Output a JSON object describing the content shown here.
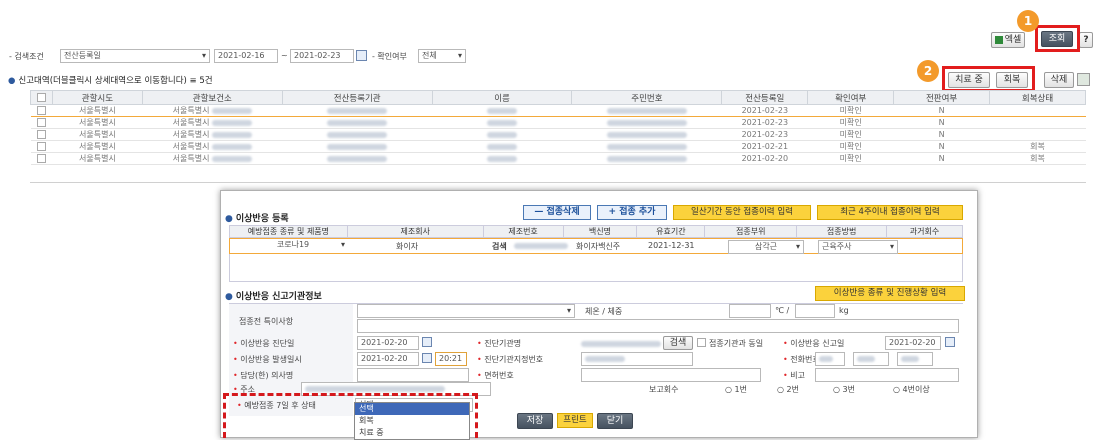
{
  "toolbar_top": {
    "excel_label": "엑셀",
    "search_button": "조회",
    "help_label": "?"
  },
  "step_badges": [
    "1",
    "2"
  ],
  "search": {
    "condition_label": "- 검색조건",
    "condition_value": "전산등록일",
    "date_from": "2021-02-16",
    "tilde": "~",
    "date_to": "2021-02-23",
    "confirm_label": "- 확인여부",
    "confirm_value": "전체"
  },
  "report_list": {
    "title": "신고대역(더블클릭시 상세대역으로 이동합니다) ≡ 5건",
    "actions": {
      "treating": "치료 중",
      "recovered": "회복",
      "delete": "삭제"
    },
    "columns": [
      "관할시도",
      "관할보건소",
      "전산등록기관",
      "이름",
      "주민번호",
      "전산등록일",
      "확인여부",
      "전판여부",
      "회복상태"
    ],
    "rows": [
      {
        "sido": "서울특별시",
        "bogeonso": "서울특별시",
        "date": "2021-02-23",
        "confirm": "미확인",
        "flag": "N",
        "status": ""
      },
      {
        "sido": "서울특별시",
        "bogeonso": "서울특별시",
        "date": "2021-02-23",
        "confirm": "미확인",
        "flag": "N",
        "status": ""
      },
      {
        "sido": "서울특별시",
        "bogeonso": "서울특별시",
        "date": "2021-02-23",
        "confirm": "미확인",
        "flag": "N",
        "status": ""
      },
      {
        "sido": "서울특별시",
        "bogeonso": "서울특별시",
        "date": "2021-02-21",
        "confirm": "미확인",
        "flag": "N",
        "status": "회복"
      },
      {
        "sido": "서울특별시",
        "bogeonso": "서울특별시",
        "date": "2021-02-20",
        "confirm": "미확인",
        "flag": "N",
        "status": "회복"
      }
    ]
  },
  "dialog": {
    "section1_title": "이상반응 등록",
    "btn_remove": "— 접종삭제",
    "btn_add": "+ 접종 추가",
    "btn_period": "일산기간 동안 접종이력 입력",
    "btn_recent": "최근 4주이내 접종이력 입력",
    "vacc_columns": [
      "예방접종 종류 및 제품명",
      "제조회사",
      "제조번호",
      "백신명",
      "유효기간",
      "접종부위",
      "접종방법",
      "과거회수"
    ],
    "vacc_row": {
      "product": "코로나19",
      "maker": "화이자",
      "search_btn": "검색",
      "vaccine": "화이자백신주",
      "expiry": "2021-12-31",
      "site": "삼각근",
      "method": "근육주사"
    },
    "section2_title": "이상반응 신고기관정보",
    "btn_type": "이상반응 종류 및 진행상황 입력",
    "fields": {
      "pre_note": "접종전 특이사항",
      "weight_label": "체온 / 체중",
      "temp_unit": "℃ /",
      "kg_unit": "kg",
      "diag_date_label": "이상반응 진단일",
      "diag_date": "2021-02-20",
      "hosp_label": "진단기관명",
      "hosp_search": "검색",
      "same_label": "접종기관과 동일",
      "report_date_label": "이상반응 신고일",
      "report_date": "2021-02-20",
      "occur_label": "이상반응 발생일시",
      "occur_date": "2021-02-20",
      "occur_time": "20:21",
      "hosp_no_label": "진단기관지정번호",
      "phone_label": "전화번호",
      "doctor_label": "담당(한) 의사명",
      "license_label": "면허번호",
      "note_label": "비고",
      "addr_label": "주소",
      "report_count_label": "보고회수",
      "radio": [
        "1번",
        "2번",
        "3번",
        "4번이상"
      ],
      "state7_label": "예방접종 7일 후 상태",
      "state7_value": "선택"
    },
    "dropdown_options": [
      "선택",
      "회복",
      "치료 중"
    ],
    "footer": {
      "save": "저장",
      "print": "프린트",
      "close": "닫기"
    }
  }
}
